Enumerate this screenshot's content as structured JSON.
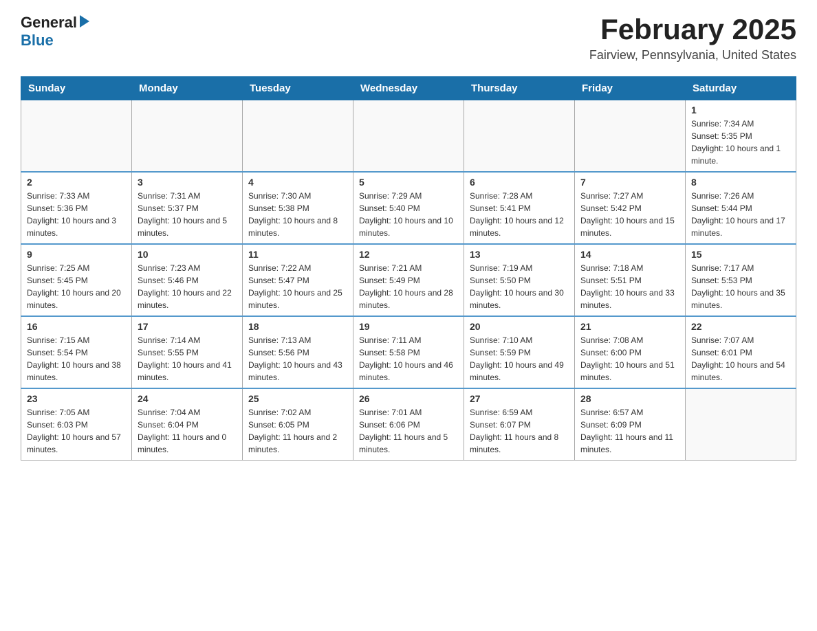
{
  "header": {
    "logo_general": "General",
    "logo_blue": "Blue",
    "title": "February 2025",
    "subtitle": "Fairview, Pennsylvania, United States"
  },
  "weekdays": [
    "Sunday",
    "Monday",
    "Tuesday",
    "Wednesday",
    "Thursday",
    "Friday",
    "Saturday"
  ],
  "weeks": [
    [
      {
        "day": "",
        "sunrise": "",
        "sunset": "",
        "daylight": ""
      },
      {
        "day": "",
        "sunrise": "",
        "sunset": "",
        "daylight": ""
      },
      {
        "day": "",
        "sunrise": "",
        "sunset": "",
        "daylight": ""
      },
      {
        "day": "",
        "sunrise": "",
        "sunset": "",
        "daylight": ""
      },
      {
        "day": "",
        "sunrise": "",
        "sunset": "",
        "daylight": ""
      },
      {
        "day": "",
        "sunrise": "",
        "sunset": "",
        "daylight": ""
      },
      {
        "day": "1",
        "sunrise": "Sunrise: 7:34 AM",
        "sunset": "Sunset: 5:35 PM",
        "daylight": "Daylight: 10 hours and 1 minute."
      }
    ],
    [
      {
        "day": "2",
        "sunrise": "Sunrise: 7:33 AM",
        "sunset": "Sunset: 5:36 PM",
        "daylight": "Daylight: 10 hours and 3 minutes."
      },
      {
        "day": "3",
        "sunrise": "Sunrise: 7:31 AM",
        "sunset": "Sunset: 5:37 PM",
        "daylight": "Daylight: 10 hours and 5 minutes."
      },
      {
        "day": "4",
        "sunrise": "Sunrise: 7:30 AM",
        "sunset": "Sunset: 5:38 PM",
        "daylight": "Daylight: 10 hours and 8 minutes."
      },
      {
        "day": "5",
        "sunrise": "Sunrise: 7:29 AM",
        "sunset": "Sunset: 5:40 PM",
        "daylight": "Daylight: 10 hours and 10 minutes."
      },
      {
        "day": "6",
        "sunrise": "Sunrise: 7:28 AM",
        "sunset": "Sunset: 5:41 PM",
        "daylight": "Daylight: 10 hours and 12 minutes."
      },
      {
        "day": "7",
        "sunrise": "Sunrise: 7:27 AM",
        "sunset": "Sunset: 5:42 PM",
        "daylight": "Daylight: 10 hours and 15 minutes."
      },
      {
        "day": "8",
        "sunrise": "Sunrise: 7:26 AM",
        "sunset": "Sunset: 5:44 PM",
        "daylight": "Daylight: 10 hours and 17 minutes."
      }
    ],
    [
      {
        "day": "9",
        "sunrise": "Sunrise: 7:25 AM",
        "sunset": "Sunset: 5:45 PM",
        "daylight": "Daylight: 10 hours and 20 minutes."
      },
      {
        "day": "10",
        "sunrise": "Sunrise: 7:23 AM",
        "sunset": "Sunset: 5:46 PM",
        "daylight": "Daylight: 10 hours and 22 minutes."
      },
      {
        "day": "11",
        "sunrise": "Sunrise: 7:22 AM",
        "sunset": "Sunset: 5:47 PM",
        "daylight": "Daylight: 10 hours and 25 minutes."
      },
      {
        "day": "12",
        "sunrise": "Sunrise: 7:21 AM",
        "sunset": "Sunset: 5:49 PM",
        "daylight": "Daylight: 10 hours and 28 minutes."
      },
      {
        "day": "13",
        "sunrise": "Sunrise: 7:19 AM",
        "sunset": "Sunset: 5:50 PM",
        "daylight": "Daylight: 10 hours and 30 minutes."
      },
      {
        "day": "14",
        "sunrise": "Sunrise: 7:18 AM",
        "sunset": "Sunset: 5:51 PM",
        "daylight": "Daylight: 10 hours and 33 minutes."
      },
      {
        "day": "15",
        "sunrise": "Sunrise: 7:17 AM",
        "sunset": "Sunset: 5:53 PM",
        "daylight": "Daylight: 10 hours and 35 minutes."
      }
    ],
    [
      {
        "day": "16",
        "sunrise": "Sunrise: 7:15 AM",
        "sunset": "Sunset: 5:54 PM",
        "daylight": "Daylight: 10 hours and 38 minutes."
      },
      {
        "day": "17",
        "sunrise": "Sunrise: 7:14 AM",
        "sunset": "Sunset: 5:55 PM",
        "daylight": "Daylight: 10 hours and 41 minutes."
      },
      {
        "day": "18",
        "sunrise": "Sunrise: 7:13 AM",
        "sunset": "Sunset: 5:56 PM",
        "daylight": "Daylight: 10 hours and 43 minutes."
      },
      {
        "day": "19",
        "sunrise": "Sunrise: 7:11 AM",
        "sunset": "Sunset: 5:58 PM",
        "daylight": "Daylight: 10 hours and 46 minutes."
      },
      {
        "day": "20",
        "sunrise": "Sunrise: 7:10 AM",
        "sunset": "Sunset: 5:59 PM",
        "daylight": "Daylight: 10 hours and 49 minutes."
      },
      {
        "day": "21",
        "sunrise": "Sunrise: 7:08 AM",
        "sunset": "Sunset: 6:00 PM",
        "daylight": "Daylight: 10 hours and 51 minutes."
      },
      {
        "day": "22",
        "sunrise": "Sunrise: 7:07 AM",
        "sunset": "Sunset: 6:01 PM",
        "daylight": "Daylight: 10 hours and 54 minutes."
      }
    ],
    [
      {
        "day": "23",
        "sunrise": "Sunrise: 7:05 AM",
        "sunset": "Sunset: 6:03 PM",
        "daylight": "Daylight: 10 hours and 57 minutes."
      },
      {
        "day": "24",
        "sunrise": "Sunrise: 7:04 AM",
        "sunset": "Sunset: 6:04 PM",
        "daylight": "Daylight: 11 hours and 0 minutes."
      },
      {
        "day": "25",
        "sunrise": "Sunrise: 7:02 AM",
        "sunset": "Sunset: 6:05 PM",
        "daylight": "Daylight: 11 hours and 2 minutes."
      },
      {
        "day": "26",
        "sunrise": "Sunrise: 7:01 AM",
        "sunset": "Sunset: 6:06 PM",
        "daylight": "Daylight: 11 hours and 5 minutes."
      },
      {
        "day": "27",
        "sunrise": "Sunrise: 6:59 AM",
        "sunset": "Sunset: 6:07 PM",
        "daylight": "Daylight: 11 hours and 8 minutes."
      },
      {
        "day": "28",
        "sunrise": "Sunrise: 6:57 AM",
        "sunset": "Sunset: 6:09 PM",
        "daylight": "Daylight: 11 hours and 11 minutes."
      },
      {
        "day": "",
        "sunrise": "",
        "sunset": "",
        "daylight": ""
      }
    ]
  ]
}
